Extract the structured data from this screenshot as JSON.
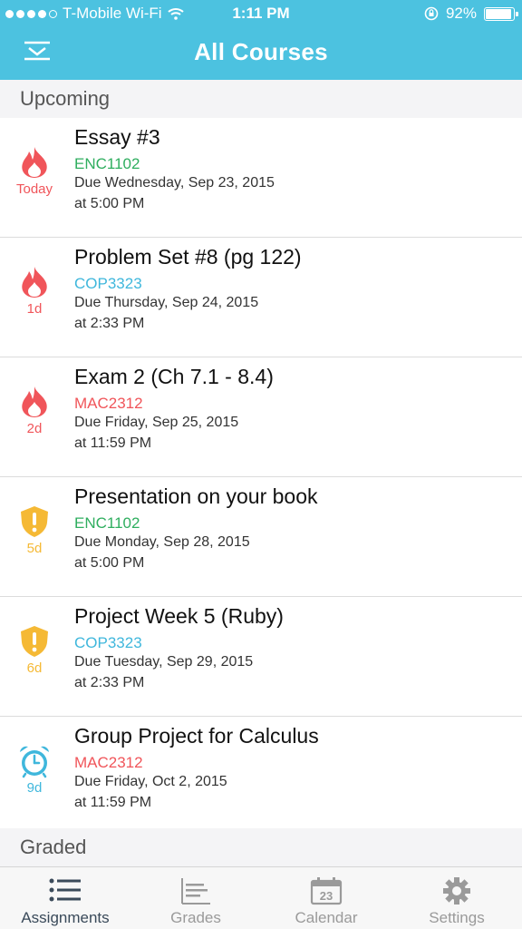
{
  "status_bar": {
    "carrier": "T-Mobile Wi-Fi",
    "time": "1:11 PM",
    "battery_text": "92%",
    "battery_level": 0.92
  },
  "header": {
    "title": "All Courses",
    "menu_icon": "dropdown-menu-icon"
  },
  "colors": {
    "header_bg": "#4cc2e0",
    "urgent_red": "#f0555a",
    "warning_yellow": "#f5b935",
    "alarm_blue": "#3fb7dc",
    "enc1102": "#2fae5f",
    "cop3323": "#3fb7dc",
    "mac2312": "#f0555a"
  },
  "sections": {
    "upcoming": "Upcoming",
    "graded": "Graded"
  },
  "assignments": [
    {
      "title": "Essay #3",
      "course": "ENC1102",
      "course_color": "#2fae5f",
      "due": "Due Wednesday, Sep 23, 2015",
      "time": "at 5:00 PM",
      "badge": "Today",
      "icon": "flame-icon",
      "badge_color": "#f0555a"
    },
    {
      "title": "Problem Set #8 (pg 122)",
      "course": "COP3323",
      "course_color": "#3fb7dc",
      "due": "Due Thursday, Sep 24, 2015",
      "time": "at 2:33 PM",
      "badge": "1d",
      "icon": "flame-icon",
      "badge_color": "#f0555a"
    },
    {
      "title": "Exam 2 (Ch 7.1 - 8.4)",
      "course": "MAC2312",
      "course_color": "#f0555a",
      "due": "Due Friday, Sep 25, 2015",
      "time": "at 11:59 PM",
      "badge": "2d",
      "icon": "flame-icon",
      "badge_color": "#f0555a"
    },
    {
      "title": "Presentation on your book",
      "course": "ENC1102",
      "course_color": "#2fae5f",
      "due": "Due Monday, Sep 28, 2015",
      "time": "at 5:00 PM",
      "badge": "5d",
      "icon": "warning-shield-icon",
      "badge_color": "#f5b935"
    },
    {
      "title": "Project Week 5 (Ruby)",
      "course": "COP3323",
      "course_color": "#3fb7dc",
      "due": "Due Tuesday, Sep 29, 2015",
      "time": "at 2:33 PM",
      "badge": "6d",
      "icon": "warning-shield-icon",
      "badge_color": "#f5b935"
    },
    {
      "title": "Group Project for Calculus",
      "course": "MAC2312",
      "course_color": "#f0555a",
      "due": "Due Friday, Oct 2, 2015",
      "time": "at 11:59 PM",
      "badge": "9d",
      "icon": "alarm-clock-icon",
      "badge_color": "#3fb7dc"
    }
  ],
  "tabs": [
    {
      "label": "Assignments",
      "icon": "list-icon",
      "active": true
    },
    {
      "label": "Grades",
      "icon": "grades-icon",
      "active": false
    },
    {
      "label": "Calendar",
      "icon": "calendar-icon",
      "calendar_day": "23",
      "active": false
    },
    {
      "label": "Settings",
      "icon": "gear-icon",
      "active": false
    }
  ]
}
